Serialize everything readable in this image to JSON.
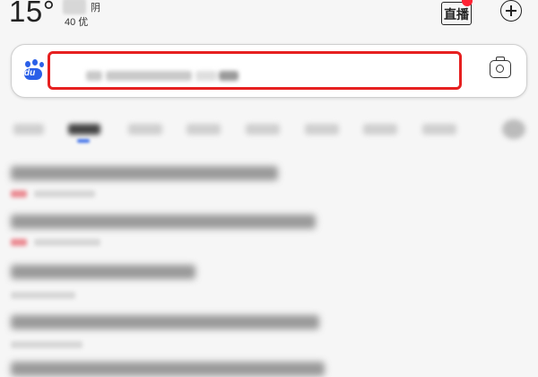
{
  "weather": {
    "temperature": "15°",
    "condition": "阴",
    "aqi": "40 优",
    "icon": "weather-cloud-icon"
  },
  "header": {
    "live_label": "直播",
    "live_icon": "live-badge-icon",
    "add_icon": "plus-circle-icon"
  },
  "search": {
    "logo_text": "du",
    "logo_icon": "baidu-paw-icon",
    "camera_icon": "camera-icon",
    "highlight_color": "#e62020",
    "brand_color": "#2a5fe8"
  },
  "tabs": {
    "active_index": 1,
    "underline_color": "#3c6ee8"
  },
  "feed": {
    "item_count": 5
  }
}
